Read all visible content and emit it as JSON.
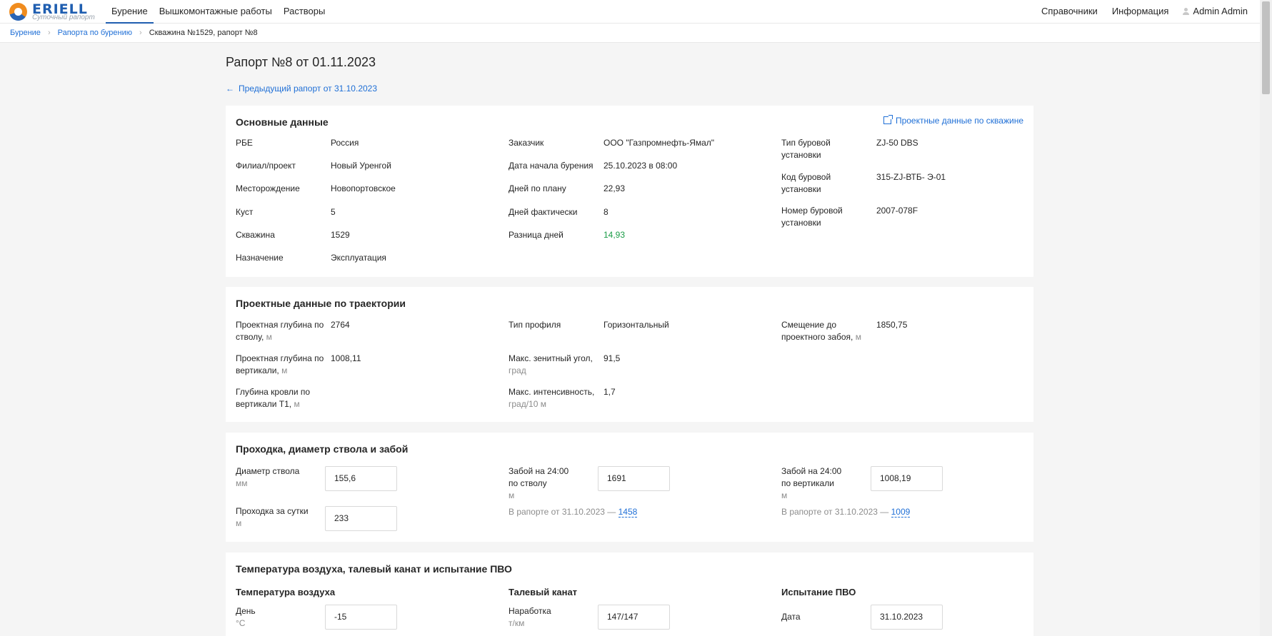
{
  "app": {
    "brand": "ERIELL",
    "subtitle": "Суточный рапорт"
  },
  "nav": {
    "left": [
      "Бурение",
      "Вышкомонтажные работы",
      "Растворы"
    ],
    "right": [
      "Справочники",
      "Информация"
    ],
    "user": "Admin Admin"
  },
  "breadcrumb": [
    "Бурение",
    "Рапорта по бурению",
    "Скважина №1529, рапорт №8"
  ],
  "page": {
    "title": "Рапорт №8 от 01.11.2023",
    "back_link": "Предыдущий рапорт от 31.10.2023"
  },
  "basic": {
    "title": "Основные данные",
    "ext_link": "Проектные данные по скважине",
    "col1": [
      {
        "label": "РБЕ",
        "value": "Россия"
      },
      {
        "label": "Филиал/проект",
        "value": "Новый Уренгой"
      },
      {
        "label": "Месторождение",
        "value": "Новопортовское"
      },
      {
        "label": "Куст",
        "value": "5"
      },
      {
        "label": "Скважина",
        "value": "1529"
      },
      {
        "label": "Назначение",
        "value": "Эксплуатация"
      }
    ],
    "col2": [
      {
        "label": "Заказчик",
        "value": "ООО \"Газпромнефть-Ямал\""
      },
      {
        "label": "Дата начала бурения",
        "value": "25.10.2023 в 08:00"
      },
      {
        "label": "Дней по плану",
        "value": "22,93"
      },
      {
        "label": "Дней фактически",
        "value": "8"
      },
      {
        "label": "Разница дней",
        "value": "14,93"
      }
    ],
    "col3": [
      {
        "label1": "Тип буровой",
        "label2": "установки",
        "value": "ZJ-50 DBS"
      },
      {
        "label1": "Код буровой",
        "label2": "установки",
        "value": "315-ZJ-ВТБ- Э-01"
      },
      {
        "label1": "Номер буровой",
        "label2": "установки",
        "value": "2007-078F"
      }
    ]
  },
  "trajectory": {
    "title": "Проектные данные по траектории",
    "c1": [
      {
        "l1": "Проектная глубина по",
        "l2": "стволу,",
        "unit": "м",
        "value": "2764"
      },
      {
        "l1": "Проектная глубина по",
        "l2": "вертикали,",
        "unit": "м",
        "value": "1008,11"
      },
      {
        "l1": "Глубина кровли по",
        "l2": "вертикали Т1,",
        "unit": "м",
        "value": ""
      }
    ],
    "c2": [
      {
        "l1": "Тип профиля",
        "l2": "",
        "unit": "",
        "value": "Горизонтальный"
      },
      {
        "l1": "Макс. зенитный угол,",
        "l2": "",
        "unit": "град",
        "value": "91,5"
      },
      {
        "l1": "Макс. интенсивность,",
        "l2": "",
        "unit": "град/10 м",
        "value": "1,7"
      }
    ],
    "c3": [
      {
        "l1": "Смещение до",
        "l2": "проектного забоя,",
        "unit": "м",
        "value": "1850,75"
      }
    ]
  },
  "drilling": {
    "title": "Проходка, диаметр ствола и забой",
    "diameter": {
      "label": "Диаметр ствола",
      "unit": "мм",
      "value": "155,6"
    },
    "daily": {
      "label": "Проходка за сутки",
      "unit": "м",
      "value": "233"
    },
    "bottom_md": {
      "l1": "Забой на 24:00",
      "l2": "по стволу",
      "unit": "м",
      "value": "1691",
      "prev_text": "В рапорте от 31.10.2023 —",
      "prev_value": "1458"
    },
    "bottom_tvd": {
      "l1": "Забой на 24:00",
      "l2": "по вертикали",
      "unit": "м",
      "value": "1008,19",
      "prev_text": "В рапорте от 31.10.2023 —",
      "prev_value": "1009"
    }
  },
  "weather": {
    "title": "Температура воздуха, талевый канат и испытание ПВО",
    "air": {
      "heading": "Температура воздуха",
      "label": "День",
      "unit": "°C",
      "value": "-15"
    },
    "rope": {
      "heading": "Талевый канат",
      "label": "Наработка",
      "unit": "т/км",
      "value": "147/147"
    },
    "bop": {
      "heading": "Испытание ПВО",
      "label": "Дата",
      "value": "31.10.2023"
    }
  }
}
